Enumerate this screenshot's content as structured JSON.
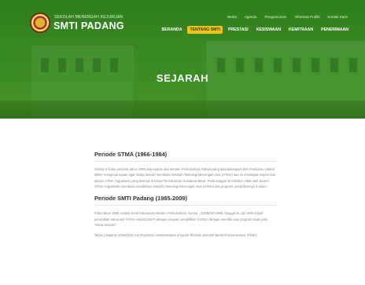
{
  "header": {
    "school_subtitle": "SEKOLAH MENENGAH KEJURUAN",
    "school_name": "SMTI PADANG",
    "top_links": [
      "Berita",
      "Agenda",
      "Pengumuman",
      "Informasi Publik",
      "Kontak Kami"
    ],
    "nav_items": [
      {
        "label": "BERANDA",
        "active": false
      },
      {
        "label": "TENTANG SMTI",
        "active": true
      },
      {
        "label": "PRESTASI",
        "active": false
      },
      {
        "label": "KESISWAAN",
        "active": false
      },
      {
        "label": "KEMITRAAN",
        "active": false
      },
      {
        "label": "PENERIMAAN",
        "active": false
      }
    ],
    "accent_color": "#f0c419"
  },
  "hero": {
    "title": "SEJARAH"
  },
  "sections": [
    {
      "title": "Periode STMA (1966-1984)",
      "paragraphs": [
        "Sekitar 6 bulan pertama tahun 1966 ada edaran dari Menteri Perindustrian Rakyat yang ditandatangani oleh Pembantu Utama Militer mengenai tujuan agar setiap daerah membuka Sekolah Teknologi Menengah Atas (STMA) dan ini mendapat respon dari alumni STMA Yogyakarta yang bekerja di Dinas Perindustrian Sumatera Barat. Pada tanggal 10 Oktober 1966 oleh alumni STMA Yogyakarta membuka mendirikan Sekolah Teknologi Menengah Atas (STMA) dan program pendidikannya 4 tahun."
      ]
    },
    {
      "title": "Periode SMTI Padang (1985-2009)",
      "paragraphs": [
        "Pada tahun 1985 melalui Surat Keputusan Menteri Perindustrian, Nomor : 225/M/SK/1985, tanggal 25 Juli 1985 terjadi perubahan nama dari STMA menjadi SMTI dengan program pendidikan 3 tahun dengan memiliki satu program studi yaitu \"Kimia Industri\".",
        "Tahun pelajaran 2009/2010 s.d 2011/2012 melaksanakan program Rintisan Sekolah Bertaraf Internasional (RSBI)."
      ]
    }
  ]
}
